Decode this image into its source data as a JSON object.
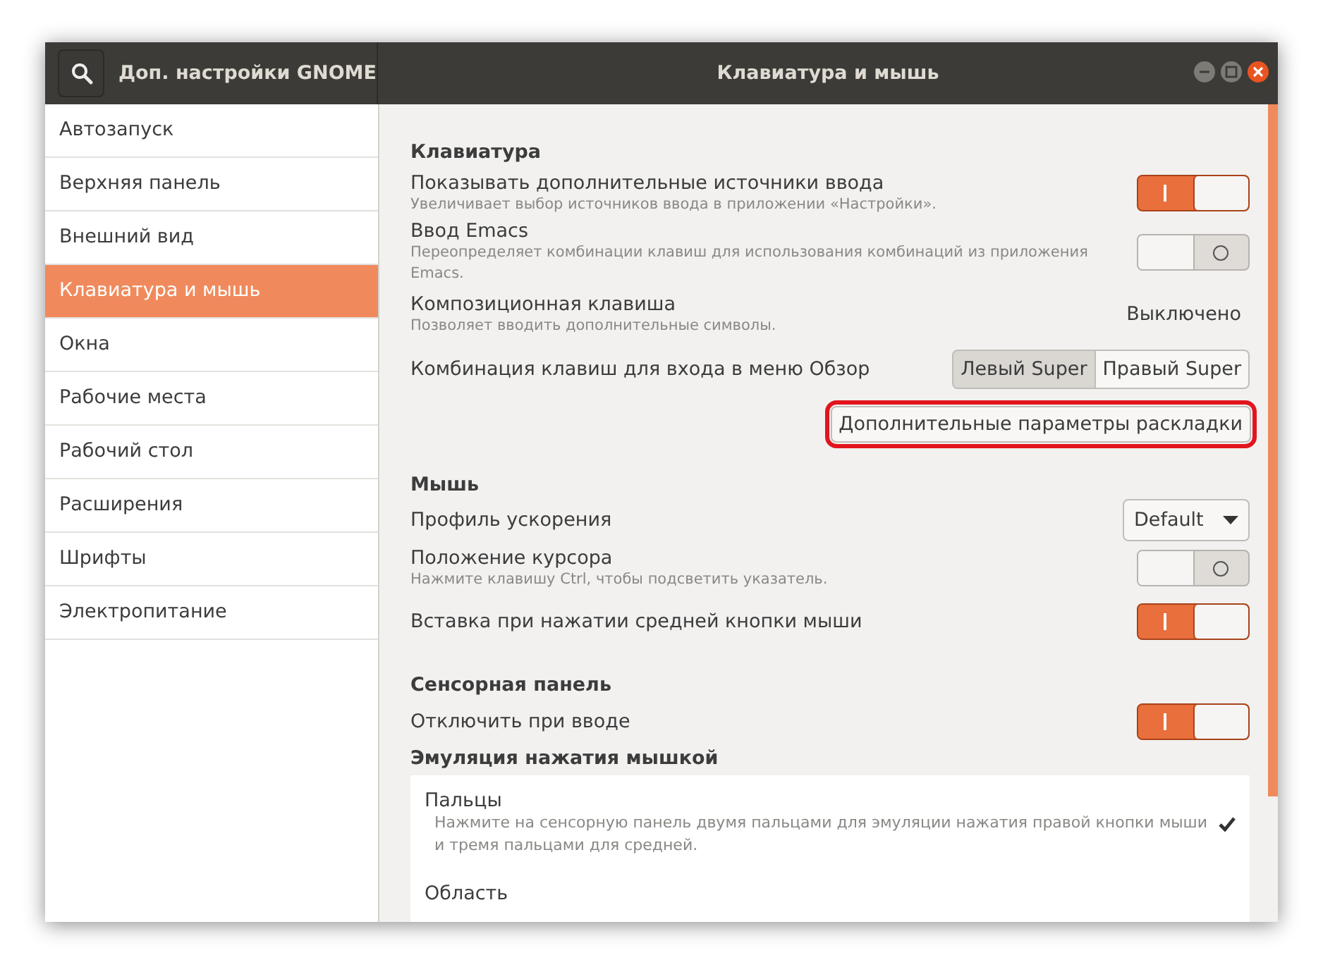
{
  "window": {
    "app_title": "Доп. настройки GNOME",
    "title": "Клавиатура и мышь"
  },
  "sidebar": {
    "items": [
      {
        "label": "Автозапуск",
        "selected": false
      },
      {
        "label": "Верхняя панель",
        "selected": false
      },
      {
        "label": "Внешний вид",
        "selected": false
      },
      {
        "label": "Клавиатура и мышь",
        "selected": true
      },
      {
        "label": "Окна",
        "selected": false
      },
      {
        "label": "Рабочие места",
        "selected": false
      },
      {
        "label": "Рабочий стол",
        "selected": false
      },
      {
        "label": "Расширения",
        "selected": false
      },
      {
        "label": "Шрифты",
        "selected": false
      },
      {
        "label": "Электропитание",
        "selected": false
      }
    ]
  },
  "sections": [
    {
      "title": "Клавиатура",
      "rows": [
        {
          "kind": "switch",
          "label": "Показывать дополнительные источники ввода",
          "description": "Увеличивает выбор источников ввода в приложении «Настройки».",
          "on": true
        },
        {
          "kind": "switch",
          "label": "Ввод Emacs",
          "description": "Переопределяет комбинации клавиш для использования комбинаций из приложения Emacs.",
          "on": false
        },
        {
          "kind": "value",
          "label": "Композиционная клавиша",
          "description": "Позволяет вводить дополнительные символы.",
          "value": "Выключено"
        },
        {
          "kind": "segmented",
          "label": "Комбинация клавиш для входа в меню Обзор",
          "options": [
            {
              "label": "Левый Super",
              "selected": true
            },
            {
              "label": "Правый Super",
              "selected": false
            }
          ]
        },
        {
          "kind": "button",
          "label": "Дополнительные параметры раскладки",
          "highlighted": true
        }
      ]
    },
    {
      "title": "Мышь",
      "rows": [
        {
          "kind": "dropdown",
          "label": "Профиль ускорения",
          "value": "Default"
        },
        {
          "kind": "switch",
          "label": "Положение курсора",
          "description": "Нажмите клавишу Ctrl, чтобы подсветить указатель.",
          "on": false
        },
        {
          "kind": "switch",
          "label": "Вставка при нажатии средней кнопки мыши",
          "on": true
        }
      ]
    },
    {
      "title": "Сенсорная панель",
      "rows": [
        {
          "kind": "switch",
          "label": "Отключить при вводе",
          "on": true
        }
      ]
    },
    {
      "title": "Эмуляция нажатия мышкой",
      "rows": [
        {
          "kind": "list",
          "items": [
            {
              "label": "Пальцы",
              "description": "Нажмите на сенсорную панель двумя пальцами для эмуляции нажатия правой кнопки мыши и тремя пальцами для средней.",
              "selected": true
            },
            {
              "label": "Область",
              "selected": false
            }
          ]
        }
      ]
    }
  ]
}
